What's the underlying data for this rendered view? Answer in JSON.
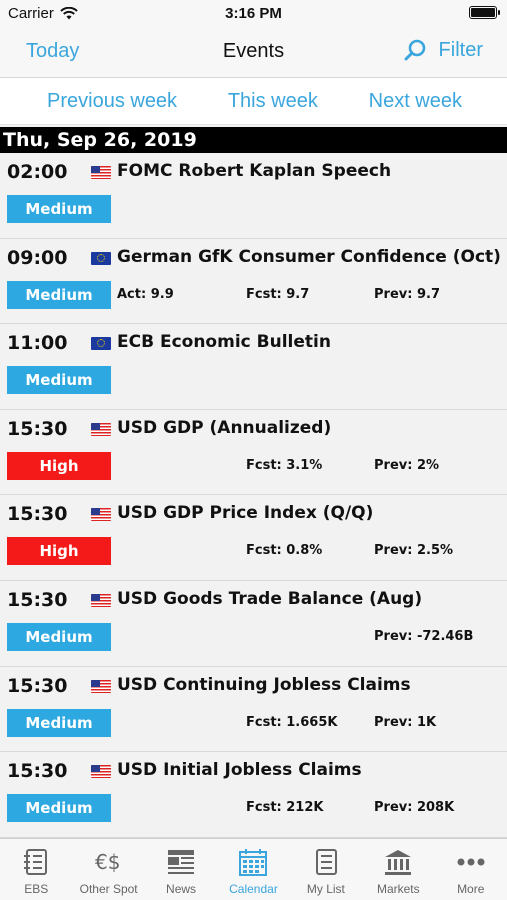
{
  "status_bar": {
    "carrier": "Carrier",
    "time": "3:16 PM"
  },
  "nav": {
    "today": "Today",
    "title": "Events",
    "filter": "Filter"
  },
  "week": {
    "previous": "Previous week",
    "this": "This week",
    "next": "Next week"
  },
  "date_header": "Thu, Sep 26, 2019",
  "events": [
    {
      "time": "02:00",
      "flag": "us",
      "title": "FOMC Robert Kaplan Speech",
      "importance": "Medium",
      "act": "",
      "fcst": "",
      "prev": ""
    },
    {
      "time": "09:00",
      "flag": "eu",
      "title": "German GfK Consumer Confidence  (Oct)",
      "importance": "Medium",
      "act": "Act: 9.9",
      "fcst": "Fcst: 9.7",
      "prev": "Prev: 9.7"
    },
    {
      "time": "11:00",
      "flag": "eu",
      "title": "ECB Economic Bulletin",
      "importance": "Medium",
      "act": "",
      "fcst": "",
      "prev": ""
    },
    {
      "time": "15:30",
      "flag": "us",
      "title": "USD GDP (Annualized)",
      "importance": "High",
      "act": "",
      "fcst": "Fcst: 3.1%",
      "prev": "Prev: 2%"
    },
    {
      "time": "15:30",
      "flag": "us",
      "title": "USD GDP Price Index (Q/Q)",
      "importance": "High",
      "act": "",
      "fcst": "Fcst: 0.8%",
      "prev": "Prev: 2.5%"
    },
    {
      "time": "15:30",
      "flag": "us",
      "title": "USD Goods Trade Balance (Aug)",
      "importance": "Medium",
      "act": "",
      "fcst": "",
      "prev": "Prev: -72.46B"
    },
    {
      "time": "15:30",
      "flag": "us",
      "title": "USD Continuing Jobless Claims",
      "importance": "Medium",
      "act": "",
      "fcst": "Fcst: 1.665K",
      "prev": "Prev: 1K"
    },
    {
      "time": "15:30",
      "flag": "us",
      "title": "USD Initial Jobless Claims",
      "importance": "Medium",
      "act": "",
      "fcst": "Fcst: 212K",
      "prev": "Prev: 208K"
    }
  ],
  "tabs": [
    {
      "label": "EBS",
      "icon": "list-icon",
      "active": false
    },
    {
      "label": "Other Spot",
      "icon": "currency-icon",
      "active": false
    },
    {
      "label": "News",
      "icon": "newspaper-icon",
      "active": false
    },
    {
      "label": "Calendar",
      "icon": "calendar-icon",
      "active": true
    },
    {
      "label": "My List",
      "icon": "mylist-icon",
      "active": false
    },
    {
      "label": "Markets",
      "icon": "bank-icon",
      "active": false
    },
    {
      "label": "More",
      "icon": "more-icon",
      "active": false
    }
  ],
  "colors": {
    "accent": "#3aa6dd",
    "medium": "#2da8e0",
    "high": "#f41a1a"
  }
}
